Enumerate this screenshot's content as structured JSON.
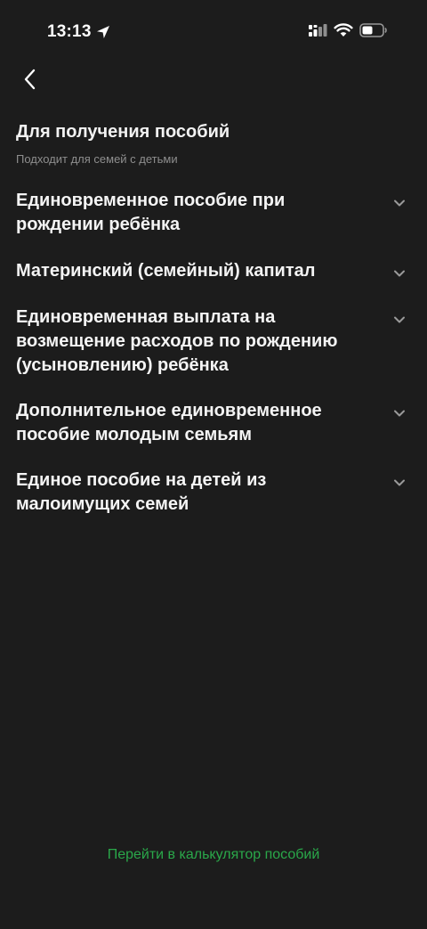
{
  "status_bar": {
    "time": "13:13"
  },
  "header": {
    "title": "Для получения пособий",
    "subtitle": "Подходит для семей с детьми"
  },
  "benefits": [
    {
      "label": "Единовременное пособие при рождении ребёнка"
    },
    {
      "label": "Материнский (семейный) капитал"
    },
    {
      "label": "Единовременная выплата на возмещение расходов по рождению (усыновлению) ребёнка"
    },
    {
      "label": "Дополнительное единовременное пособие молодым семьям"
    },
    {
      "label": "Единое пособие на детей из малоимущих семей"
    }
  ],
  "footer": {
    "calculator_link": "Перейти в калькулятор пособий"
  },
  "colors": {
    "background": "#1c1c1c",
    "link": "#2aa84a",
    "subtitle": "#8e8e8e"
  },
  "icons": {
    "back": "chevron-left-icon",
    "expand": "chevron-down-icon",
    "location": "location-arrow-icon",
    "signal": "signal-icon",
    "wifi": "wifi-icon",
    "battery": "battery-icon"
  }
}
